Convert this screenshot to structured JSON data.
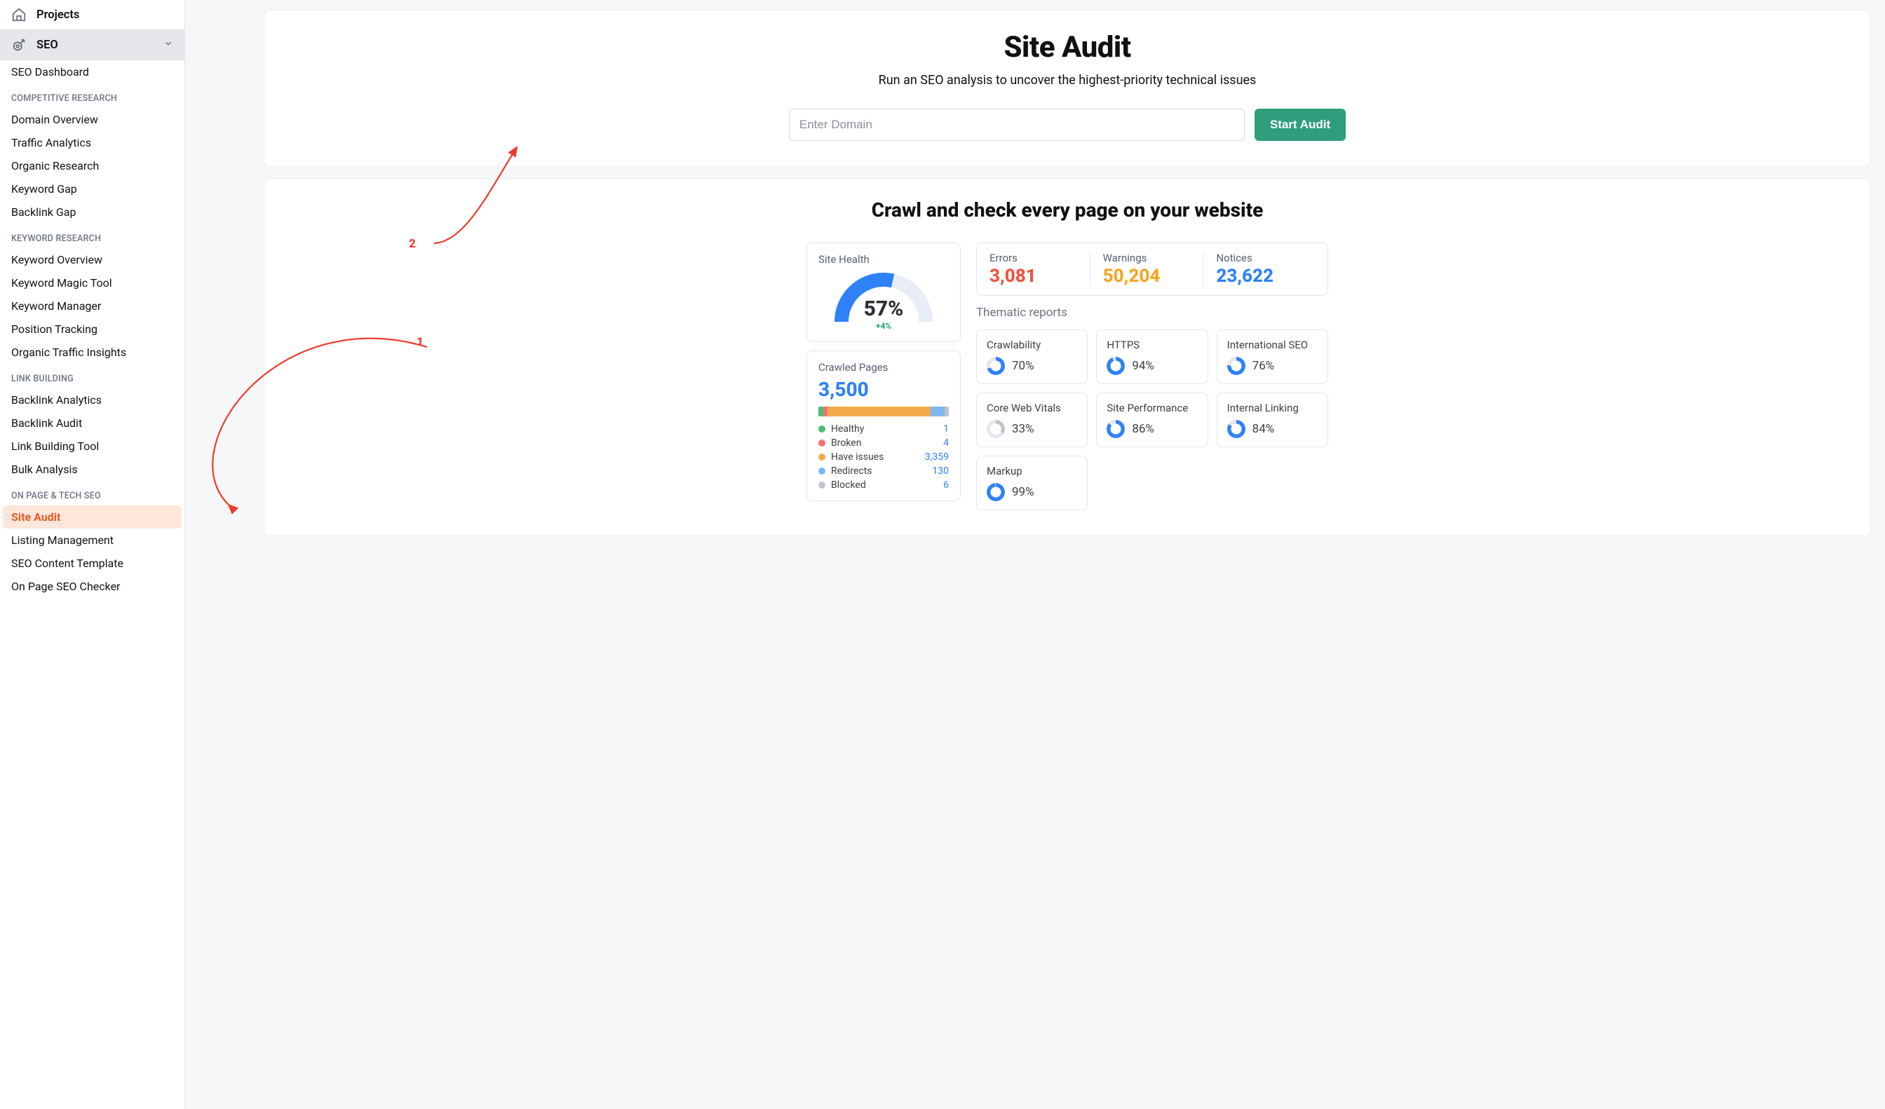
{
  "sidebar": {
    "top": {
      "projects": "Projects",
      "seo": "SEO"
    },
    "seo_children": {
      "dashboard": "SEO Dashboard"
    },
    "groups": [
      {
        "label": "COMPETITIVE RESEARCH",
        "items": [
          "Domain Overview",
          "Traffic Analytics",
          "Organic Research",
          "Keyword Gap",
          "Backlink Gap"
        ]
      },
      {
        "label": "KEYWORD RESEARCH",
        "items": [
          "Keyword Overview",
          "Keyword Magic Tool",
          "Keyword Manager",
          "Position Tracking",
          "Organic Traffic Insights"
        ]
      },
      {
        "label": "LINK BUILDING",
        "items": [
          "Backlink Analytics",
          "Backlink Audit",
          "Link Building Tool",
          "Bulk Analysis"
        ]
      },
      {
        "label": "ON PAGE & TECH SEO",
        "items": [
          "Site Audit",
          "Listing Management",
          "SEO Content Template",
          "On Page SEO Checker"
        ],
        "active_index": 0
      }
    ]
  },
  "hero": {
    "title": "Site Audit",
    "subtitle": "Run an SEO analysis to uncover the highest-priority technical issues",
    "placeholder": "Enter Domain",
    "button": "Start Audit"
  },
  "crawl": {
    "title": "Crawl and check every page on your website",
    "site_health": {
      "label": "Site Health",
      "pct": "57%",
      "pct_num": 57,
      "delta": "+4%"
    },
    "crawled": {
      "label": "Crawled Pages",
      "total": "3,500",
      "legend": [
        {
          "label": "Healthy",
          "value": "1",
          "color": "#4dbf7b",
          "frac": 3.5
        },
        {
          "label": "Broken",
          "value": "4",
          "color": "#f17272",
          "frac": 3.5
        },
        {
          "label": "Have issues",
          "value": "3,359",
          "color": "#f4a94b",
          "frac": 79
        },
        {
          "label": "Redirects",
          "value": "130",
          "color": "#7db7f0",
          "frac": 11
        },
        {
          "label": "Blocked",
          "value": "6",
          "color": "#bfc4cc",
          "frac": 3
        }
      ]
    },
    "trio": {
      "errors": {
        "label": "Errors",
        "value": "3,081"
      },
      "warnings": {
        "label": "Warnings",
        "value": "50,204"
      },
      "notices": {
        "label": "Notices",
        "value": "23,622"
      }
    },
    "thematic": {
      "label": "Thematic reports",
      "cards": [
        {
          "label": "Crawlability",
          "pct": "70%",
          "num": 70,
          "color": "#2f81f7"
        },
        {
          "label": "HTTPS",
          "pct": "94%",
          "num": 94,
          "color": "#2f81f7"
        },
        {
          "label": "International SEO",
          "pct": "76%",
          "num": 76,
          "color": "#2f81f7"
        },
        {
          "label": "Core Web Vitals",
          "pct": "33%",
          "num": 33,
          "color": "#bfc4cc"
        },
        {
          "label": "Site Performance",
          "pct": "86%",
          "num": 86,
          "color": "#2f81f7"
        },
        {
          "label": "Internal Linking",
          "pct": "84%",
          "num": 84,
          "color": "#2f81f7"
        },
        {
          "label": "Markup",
          "pct": "99%",
          "num": 99,
          "color": "#2f81f7"
        }
      ]
    }
  },
  "annotations": {
    "one": "1",
    "two": "2"
  }
}
